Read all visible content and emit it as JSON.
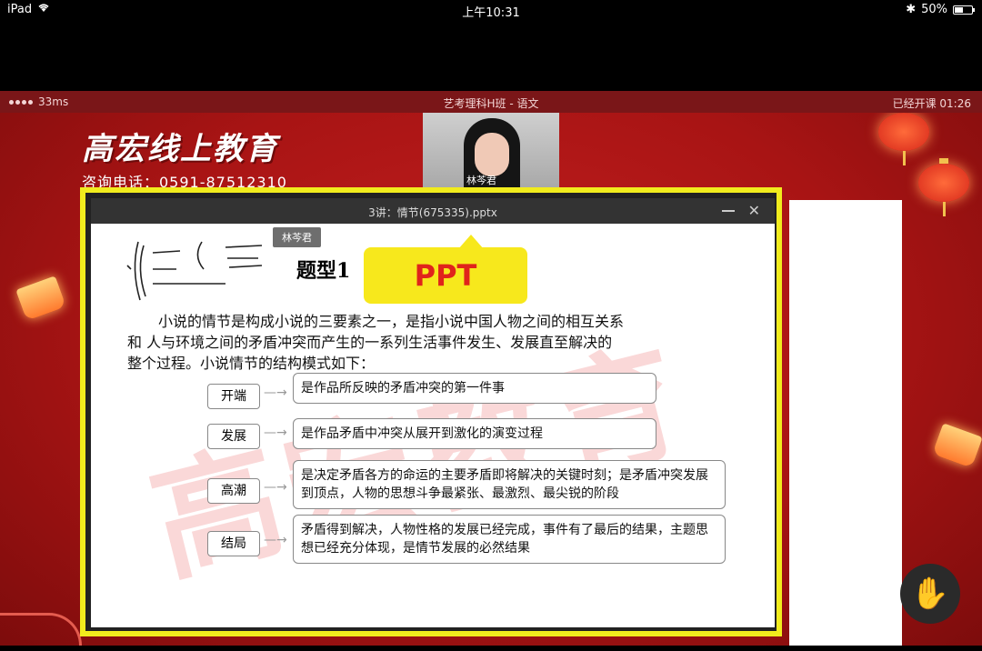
{
  "status_bar": {
    "device": "iPad",
    "time": "上午10:31",
    "battery": "50%",
    "battery_level": 0.5
  },
  "app_bar": {
    "latency": "33ms",
    "class_title": "艺考理科H班 - 语文",
    "elapsed": "已经开课  01:26"
  },
  "brand": {
    "logo": "高宏线上教育",
    "phone": "咨询电话：0591-87512310"
  },
  "camera": {
    "name": "林芩君"
  },
  "ppt_window": {
    "title": "3讲：情节(675335).pptx"
  },
  "slide": {
    "tooltip": "林芩君",
    "title": "题型1",
    "bubble": "PPT",
    "watermark": "高宏教育",
    "paragraph": [
      "小说的情节是构成小说的三要素之一，是指小说中国人物之间的相互关系",
      "和  人与环境之间的矛盾冲突而产生的一系列生活事件发生、发展直至解决的",
      "整个过程。小说情节的结构模式如下："
    ],
    "stages": [
      {
        "label": "开端",
        "desc": "是作品所反映的矛盾冲突的第一件事"
      },
      {
        "label": "发展",
        "desc": "是作品矛盾中冲突从展开到激化的演变过程"
      },
      {
        "label": "高潮",
        "desc": "是决定矛盾各方的命运的主要矛盾即将解决的关键时刻；是矛盾冲突发展到顶点，人物的思想斗争最紧张、最激烈、最尖锐的阶段"
      },
      {
        "label": "结局",
        "desc": "矛盾得到解决，人物性格的发展已经完成，事件有了最后的结果，主题思想已经充分体现，是情节发展的必然结果"
      }
    ]
  },
  "colors": {
    "frame_highlight": "#f1ec1d",
    "bubble_text": "#e0241b",
    "stage_red": "#b01818"
  }
}
